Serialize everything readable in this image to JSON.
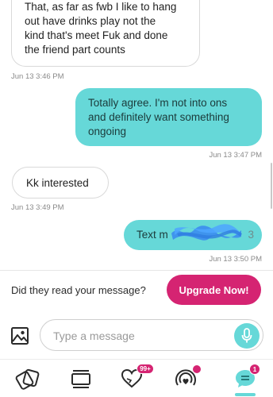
{
  "messages": [
    {
      "direction": "in",
      "lines": [
        "That, as far as fwb I like to hang",
        "out have drinks play not the",
        "kind that's meet Fuk and done",
        "the friend part counts"
      ],
      "timestamp": "Jun 13 3:46 PM"
    },
    {
      "direction": "out",
      "lines": [
        "Totally agree.  I'm not into ons",
        "and definitely want something",
        "ongoing"
      ],
      "timestamp": "Jun 13 3:47 PM"
    },
    {
      "direction": "in",
      "lines": [
        "Kk interested"
      ],
      "timestamp": "Jun 13 3:49 PM"
    },
    {
      "direction": "out",
      "lines": [
        "Text m"
      ],
      "tail_text": "3",
      "timestamp": "Jun 13 3:50 PM"
    }
  ],
  "read_prompt": {
    "text": "Did they read your message?",
    "button_label": "Upgrade Now!"
  },
  "composer": {
    "placeholder": "Type a message",
    "image_icon": "image-icon",
    "mic_icon": "microphone-icon"
  },
  "nav": {
    "items": [
      {
        "icon": "cards-icon",
        "badge": ""
      },
      {
        "icon": "stack-icon",
        "badge": ""
      },
      {
        "icon": "heart-hands-icon",
        "badge": "99+"
      },
      {
        "icon": "live-broadcast-icon",
        "badge": ""
      },
      {
        "icon": "chat-icon",
        "badge": "1"
      }
    ],
    "active": "chat"
  },
  "colors": {
    "accent": "#66d8d8",
    "brand": "#d52472"
  }
}
